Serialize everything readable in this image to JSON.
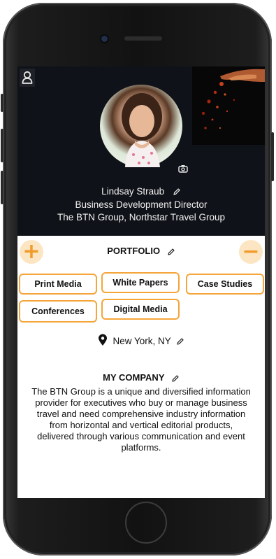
{
  "profile": {
    "name": "Lindsay Straub",
    "title": "Business Development Director",
    "company": "The BTN Group, Northstar Travel Group"
  },
  "portfolio": {
    "heading": "PORTFOLIO",
    "add_label": "+",
    "remove_label": "−",
    "chips": [
      "Print Media",
      "White Papers",
      "Case Studies",
      "Conferences",
      "Digital Media"
    ]
  },
  "location": {
    "text": "New York, NY"
  },
  "company_section": {
    "heading": "MY COMPANY",
    "description": "The BTN Group is a unique and diversified information provider for executives who buy or manage business travel and need comprehensive industry information from horizontal and vertical editorial products, delivered through various communication and event platforms."
  },
  "colors": {
    "accent": "#f5a53a",
    "accent_light": "#fce5c2",
    "header_bg": "#0f1218"
  },
  "icons": [
    "user-icon",
    "camera-icon",
    "pencil-icon",
    "map-pin-icon"
  ]
}
